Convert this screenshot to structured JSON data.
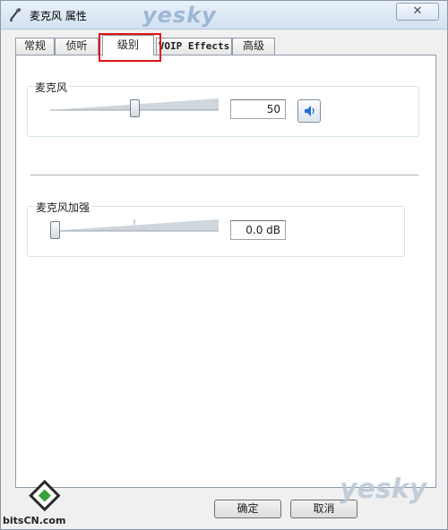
{
  "window": {
    "title": "麦克风 属性",
    "watermark_top": "yesky",
    "close_label": "✕"
  },
  "tabs": [
    {
      "label": "常规",
      "active": false
    },
    {
      "label": "侦听",
      "active": false
    },
    {
      "label": "级别",
      "active": true
    },
    {
      "label": "VOIP Effects",
      "active": false
    },
    {
      "label": "高级",
      "active": false
    }
  ],
  "microphone": {
    "label": "麦克风",
    "value": "50",
    "level": 50,
    "speaker_icon": "speaker-icon"
  },
  "boost": {
    "label": "麦克风加强",
    "value": "0.0 dB",
    "level": 0
  },
  "buttons": {
    "ok": "确定",
    "cancel": "取消"
  },
  "branding": {
    "logo_text": "bitsCN.com",
    "watermark_bottom": "yesky"
  },
  "colors": {
    "highlight": "#e01212",
    "slider_fill": "#cfd6dc",
    "speaker": "#1f6fd0"
  }
}
